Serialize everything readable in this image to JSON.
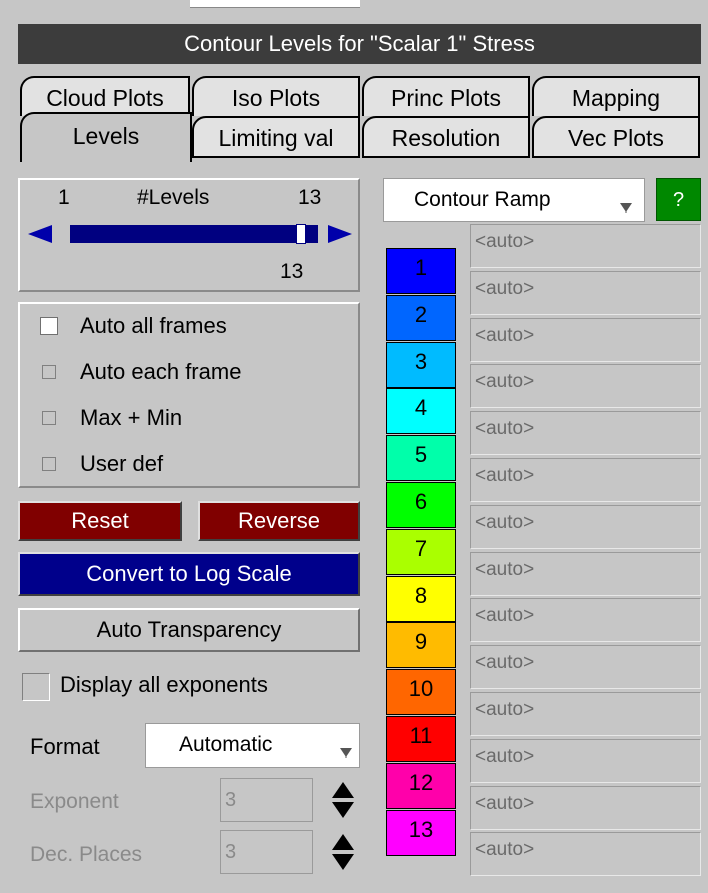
{
  "title": "Contour Levels for \"Scalar 1\" Stress",
  "tabs_row1": [
    "Cloud Plots",
    "Iso Plots",
    "Princ Plots",
    "Mapping"
  ],
  "tabs_row2": [
    "Levels",
    "Limiting val",
    "Resolution",
    "Vec Plots"
  ],
  "levels_slider": {
    "min": "1",
    "label": "#Levels",
    "max": "13",
    "value": "13",
    "fill_fraction": 1.0
  },
  "auto_options": [
    "Auto all frames",
    "Auto each frame",
    "Max + Min",
    "User def"
  ],
  "buttons": {
    "reset": "Reset",
    "reverse": "Reverse",
    "log_scale": "Convert to Log Scale",
    "transparency": "Auto Transparency"
  },
  "display_exponents": "Display all exponents",
  "format": {
    "label": "Format",
    "value": "Automatic"
  },
  "exponent": {
    "label": "Exponent",
    "value": "3"
  },
  "dec_places": {
    "label": "Dec. Places",
    "value": "3"
  },
  "contour_select": "Contour Ramp",
  "help": "?",
  "levels": [
    {
      "n": "1",
      "color": "#0000ff"
    },
    {
      "n": "2",
      "color": "#0066ff"
    },
    {
      "n": "3",
      "color": "#00bbff"
    },
    {
      "n": "4",
      "color": "#00ffff"
    },
    {
      "n": "5",
      "color": "#00ffaa"
    },
    {
      "n": "6",
      "color": "#00ff00"
    },
    {
      "n": "7",
      "color": "#aaff00"
    },
    {
      "n": "8",
      "color": "#ffff00"
    },
    {
      "n": "9",
      "color": "#ffbb00"
    },
    {
      "n": "10",
      "color": "#ff6600"
    },
    {
      "n": "11",
      "color": "#ff0000"
    },
    {
      "n": "12",
      "color": "#ff00aa"
    },
    {
      "n": "13",
      "color": "#ff00ff"
    }
  ],
  "auto_values": [
    "<auto>",
    "<auto>",
    "<auto>",
    "<auto>",
    "<auto>",
    "<auto>",
    "<auto>",
    "<auto>",
    "<auto>",
    "<auto>",
    "<auto>",
    "<auto>",
    "<auto>",
    "<auto>"
  ],
  "colors": {
    "reset": "#800000",
    "log_btn": "#00008b",
    "slider": "#000080",
    "help": "#008800"
  }
}
